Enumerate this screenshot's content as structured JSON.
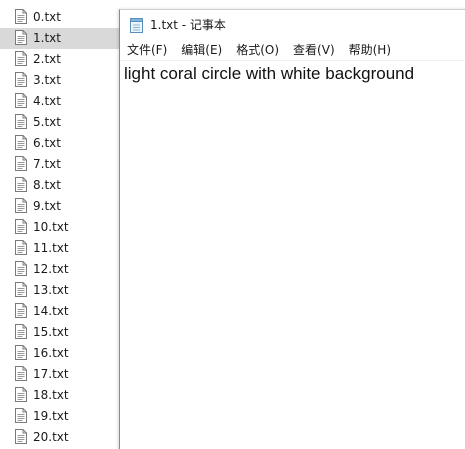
{
  "files": [
    {
      "label": "0.txt",
      "selected": false
    },
    {
      "label": "1.txt",
      "selected": true
    },
    {
      "label": "2.txt",
      "selected": false
    },
    {
      "label": "3.txt",
      "selected": false
    },
    {
      "label": "4.txt",
      "selected": false
    },
    {
      "label": "5.txt",
      "selected": false
    },
    {
      "label": "6.txt",
      "selected": false
    },
    {
      "label": "7.txt",
      "selected": false
    },
    {
      "label": "8.txt",
      "selected": false
    },
    {
      "label": "9.txt",
      "selected": false
    },
    {
      "label": "10.txt",
      "selected": false
    },
    {
      "label": "11.txt",
      "selected": false
    },
    {
      "label": "12.txt",
      "selected": false
    },
    {
      "label": "13.txt",
      "selected": false
    },
    {
      "label": "14.txt",
      "selected": false
    },
    {
      "label": "15.txt",
      "selected": false
    },
    {
      "label": "16.txt",
      "selected": false
    },
    {
      "label": "17.txt",
      "selected": false
    },
    {
      "label": "18.txt",
      "selected": false
    },
    {
      "label": "19.txt",
      "selected": false
    },
    {
      "label": "20.txt",
      "selected": false
    }
  ],
  "file_icon": "text-file-icon",
  "notepad": {
    "title": "1.txt - 记事本",
    "icon": "notepad-icon",
    "menu": [
      {
        "label": "文件(F)"
      },
      {
        "label": "编辑(E)"
      },
      {
        "label": "格式(O)"
      },
      {
        "label": "查看(V)"
      },
      {
        "label": "帮助(H)"
      }
    ],
    "content": "light coral circle with white background"
  },
  "colors": {
    "selection": "#d9d9d9",
    "window_border": "#8a8a8a",
    "text": "#1a1a1a"
  }
}
